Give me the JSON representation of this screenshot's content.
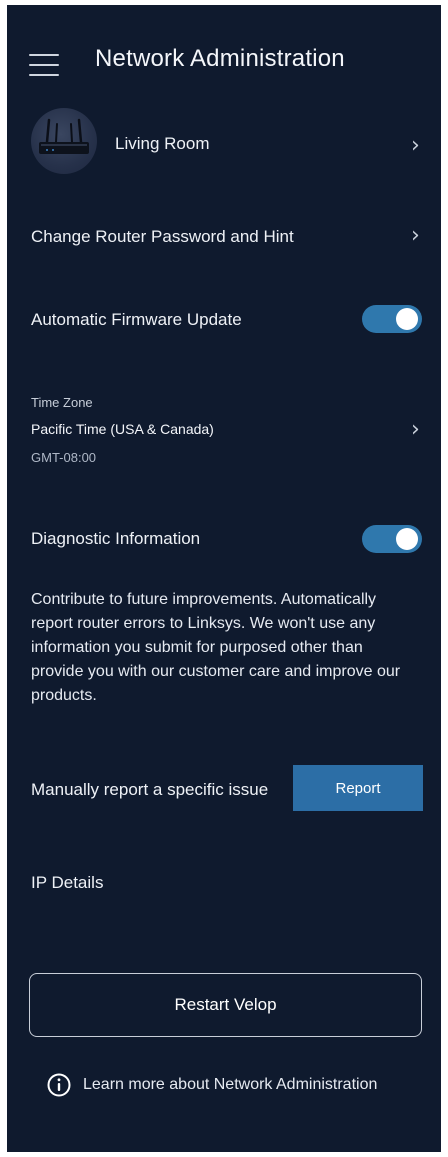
{
  "header": {
    "title": "Network Administration"
  },
  "router": {
    "name": "Living Room"
  },
  "rows": {
    "change_password": "Change Router Password and Hint",
    "firmware_update": "Automatic Firmware Update",
    "diagnostic": "Diagnostic Information",
    "manual_report": "Manually report a specific issue",
    "ip_details": "IP Details"
  },
  "toggles": {
    "firmware_update_on": true,
    "diagnostic_on": true
  },
  "time_zone": {
    "label": "Time Zone",
    "value": "Pacific Time (USA & Canada)",
    "offset": "GMT-08:00"
  },
  "diagnostic_description": "Contribute to future improvements. Automatically report router errors to Linksys. We won't use any information you submit for purposed other than provide you with our customer care and improve our products.",
  "buttons": {
    "report": "Report",
    "restart": "Restart Velop"
  },
  "footer": {
    "learn_more": "Learn more about Network Administration"
  },
  "icons": {
    "menu": "hamburger-menu-icon",
    "chevron": "chevron-right-icon",
    "info": "info-circle-icon",
    "router": "router-image"
  },
  "colors": {
    "background": "#0f1a2e",
    "toggle_on": "#2f78ad",
    "report_button": "#2c6ea6",
    "text": "#f2f4f8"
  }
}
